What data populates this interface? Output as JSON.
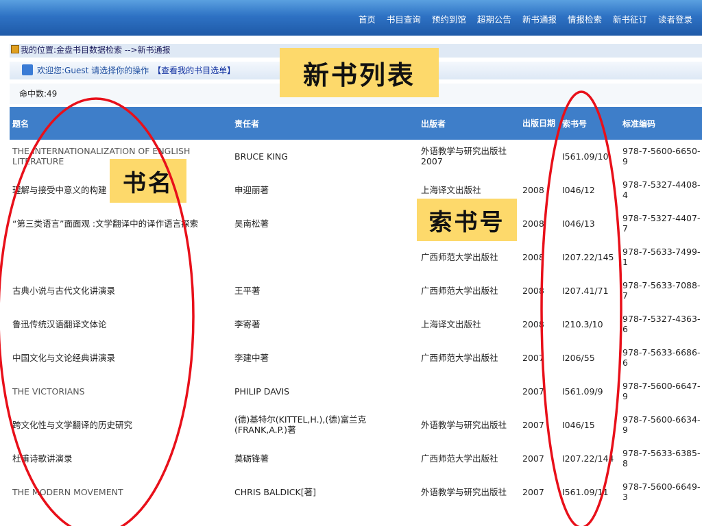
{
  "nav": [
    "首页",
    "书目查询",
    "预约到馆",
    "超期公告",
    "新书通报",
    "情报检索",
    "新书征订",
    "读者登录"
  ],
  "breadcrumb": "我的位置:金盘书目数据检索 -->新书通报",
  "welcome": {
    "text": "欢迎您:Guest 请选择你的操作",
    "link": "【查看我的书目选单】"
  },
  "hit_count": "命中数:49",
  "columns": [
    "题名",
    "责任者",
    "出版者",
    "出版日期",
    "索书号",
    "标准编码"
  ],
  "rows": [
    [
      "THE INTERNATIONALIZATION OF ENGLISH LITERATURE",
      "BRUCE KING",
      "外语教学与研究出版社2007",
      "",
      "I561.09/10",
      "978-7-5600-6650-9"
    ],
    [
      "理解与接受中意义的构建 ……研究",
      "申迎丽著",
      "上海译文出版社",
      "2008",
      "I046/12",
      "978-7-5327-4408-4"
    ],
    [
      "“第三类语言”面面观 :文学翻译中的译作语言探索",
      "吴南松著",
      "",
      "2008",
      "I046/13",
      "978-7-5327-4407-7"
    ],
    [
      "",
      "",
      "广西师范大学出版社",
      "2008",
      "I207.22/145",
      "978-7-5633-7499-1"
    ],
    [
      "古典小说与古代文化讲演录",
      "王平著",
      "广西师范大学出版社",
      "2008",
      "I207.41/71",
      "978-7-5633-7088-7"
    ],
    [
      "鲁迅传统汉语翻译文体论",
      "李寄著",
      "上海译文出版社",
      "2008",
      "I210.3/10",
      "978-7-5327-4363-6"
    ],
    [
      "中国文化与文论经典讲演录",
      "李建中著",
      "广西师范大学出版社",
      "2007",
      "I206/55",
      "978-7-5633-6686-6"
    ],
    [
      "THE VICTORIANS",
      "PHILIP DAVIS",
      "",
      "2007",
      "I561.09/9",
      "978-7-5600-6647-9"
    ],
    [
      "跨文化性与文学翻译的历史研究",
      "(德)基特尔(KITTEL,H.),(德)富兰克(FRANK,A.P.)著",
      "外语教学与研究出版社",
      "2007",
      "I046/15",
      "978-7-5600-6634-9"
    ],
    [
      "杜甫诗歌讲演录",
      "莫砺锋著",
      "广西师范大学出版社",
      "2007",
      "I207.22/144",
      "978-7-5633-6385-8"
    ],
    [
      "THE MODERN MOVEMENT",
      "CHRIS BALDICK[著]",
      "外语教学与研究出版社",
      "2007",
      "I561.09/11",
      "978-7-5600-6649-3"
    ]
  ],
  "callouts": {
    "title": "新书列表",
    "book_name": "书名",
    "call_number": "索书号"
  },
  "colors": {
    "header_blue": "#3e7ec9",
    "callout_yellow": "#fdd96b",
    "oval_red": "#e8101a"
  }
}
